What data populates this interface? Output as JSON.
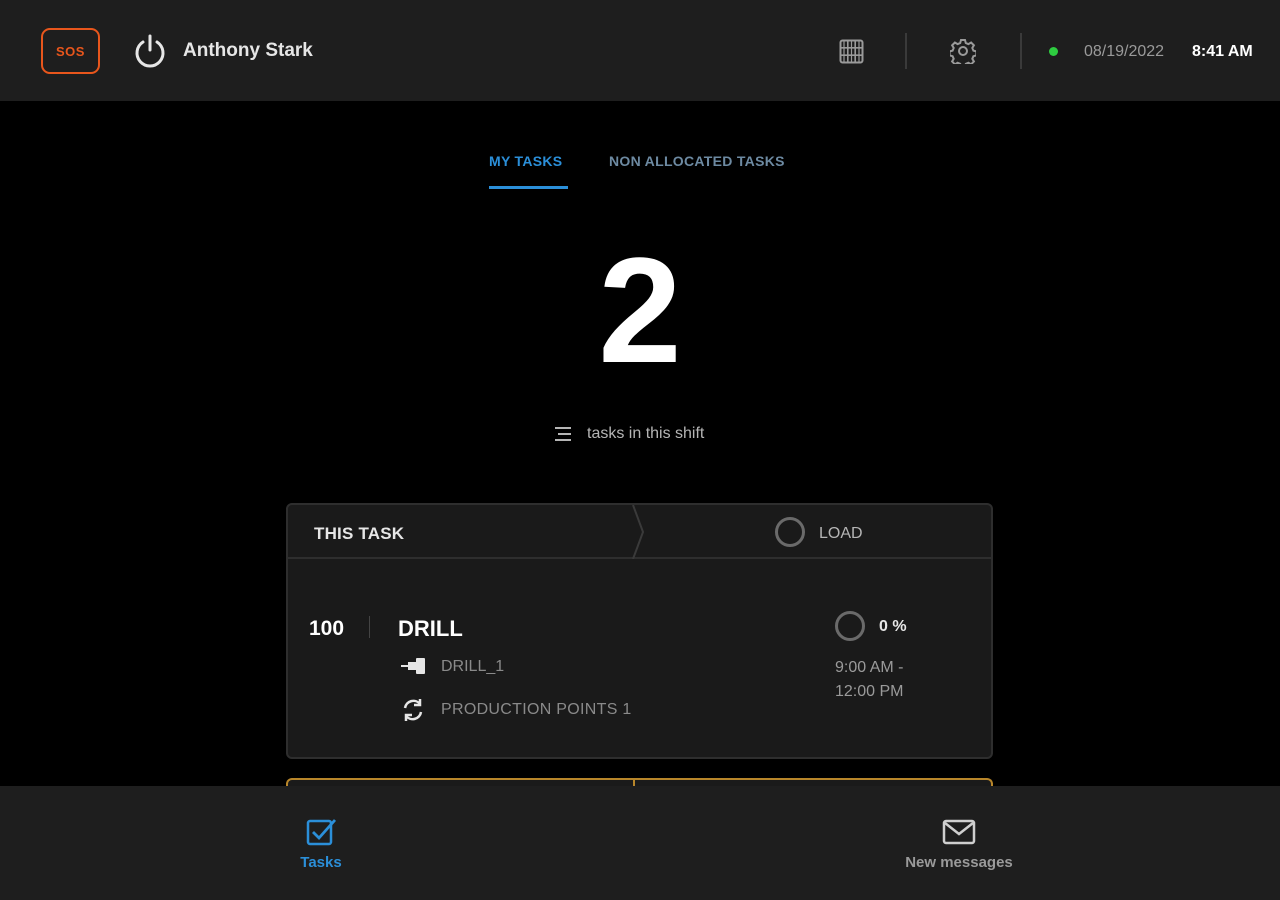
{
  "header": {
    "sos_label": "SOS",
    "user_name": "Anthony Stark",
    "date": "08/19/2022",
    "time": "8:41 AM",
    "connection_status_color": "#2ecc40"
  },
  "tabs": [
    {
      "label": "MY TASKS",
      "active": true
    },
    {
      "label": "NON ALLOCATED TASKS",
      "active": false
    }
  ],
  "summary": {
    "task_count": "2",
    "task_count_label": "tasks in this shift"
  },
  "current_task": {
    "header_label": "THIS TASK",
    "action_label": "LOAD",
    "number": "100",
    "name": "DRILL",
    "machine": "DRILL_1",
    "production_points": "PRODUCTION POINTS 1",
    "progress_label": "0 %",
    "time_start": "9:00 AM -",
    "time_end": "12:00 PM"
  },
  "bottom_nav": {
    "tasks_label": "Tasks",
    "messages_label": "New messages"
  },
  "colors": {
    "accent": "#2b8fd9",
    "sos": "#e8561c",
    "next_card_border": "#b8862a"
  }
}
